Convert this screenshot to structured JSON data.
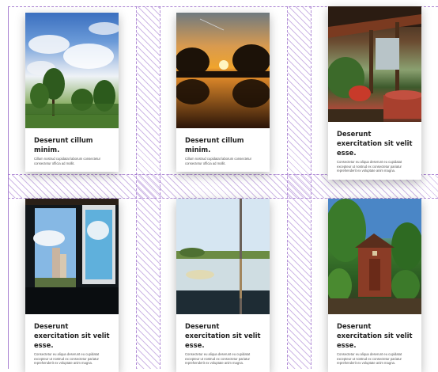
{
  "cards": [
    {
      "title": "Deserunt cillum minim.",
      "text": "Cillum nostrud cupidatat laborum consectetur consectetur officia ad mollit.",
      "image": "cloudy-sky-trees-photo"
    },
    {
      "title": "Deserunt cillum minim.",
      "text": "Cillum nostrud cupidatat laborum consectetur consectetur officia ad mollit.",
      "image": "sunset-lake-photo"
    },
    {
      "title": "Deserunt exercitation sit velit esse.",
      "text": "Consectetur eu aliqua deserunt eu cupidatat excepteur ut nostrud ex consectetur pariatur reprehenderit ex voluptate anim magna.",
      "image": "garden-terrace-photo"
    },
    {
      "title": "Deserunt exercitation sit velit esse.",
      "text": "Consectetur eu aliqua deserunt eu cupidatat excepteur ut nostrud ex consectetur pariatur reprehenderit ex voluptate anim magna.",
      "image": "open-window-photo"
    },
    {
      "title": "Deserunt exercitation sit velit esse.",
      "text": "Consectetur eu aliqua deserunt eu cupidatat excepteur ut nostrud ex consectetur pariatur reprehenderit ex voluptate anim magna.",
      "image": "lake-reflection-photo"
    },
    {
      "title": "Deserunt exercitation sit velit esse.",
      "text": "Consectetur eu aliqua deserunt eu cupidatat excepteur ut nostrud ex consectetur pariatur reprehenderit ex voluptate anim magna.",
      "image": "garden-shed-photo"
    }
  ],
  "overlay_color": "#9b6fd0"
}
